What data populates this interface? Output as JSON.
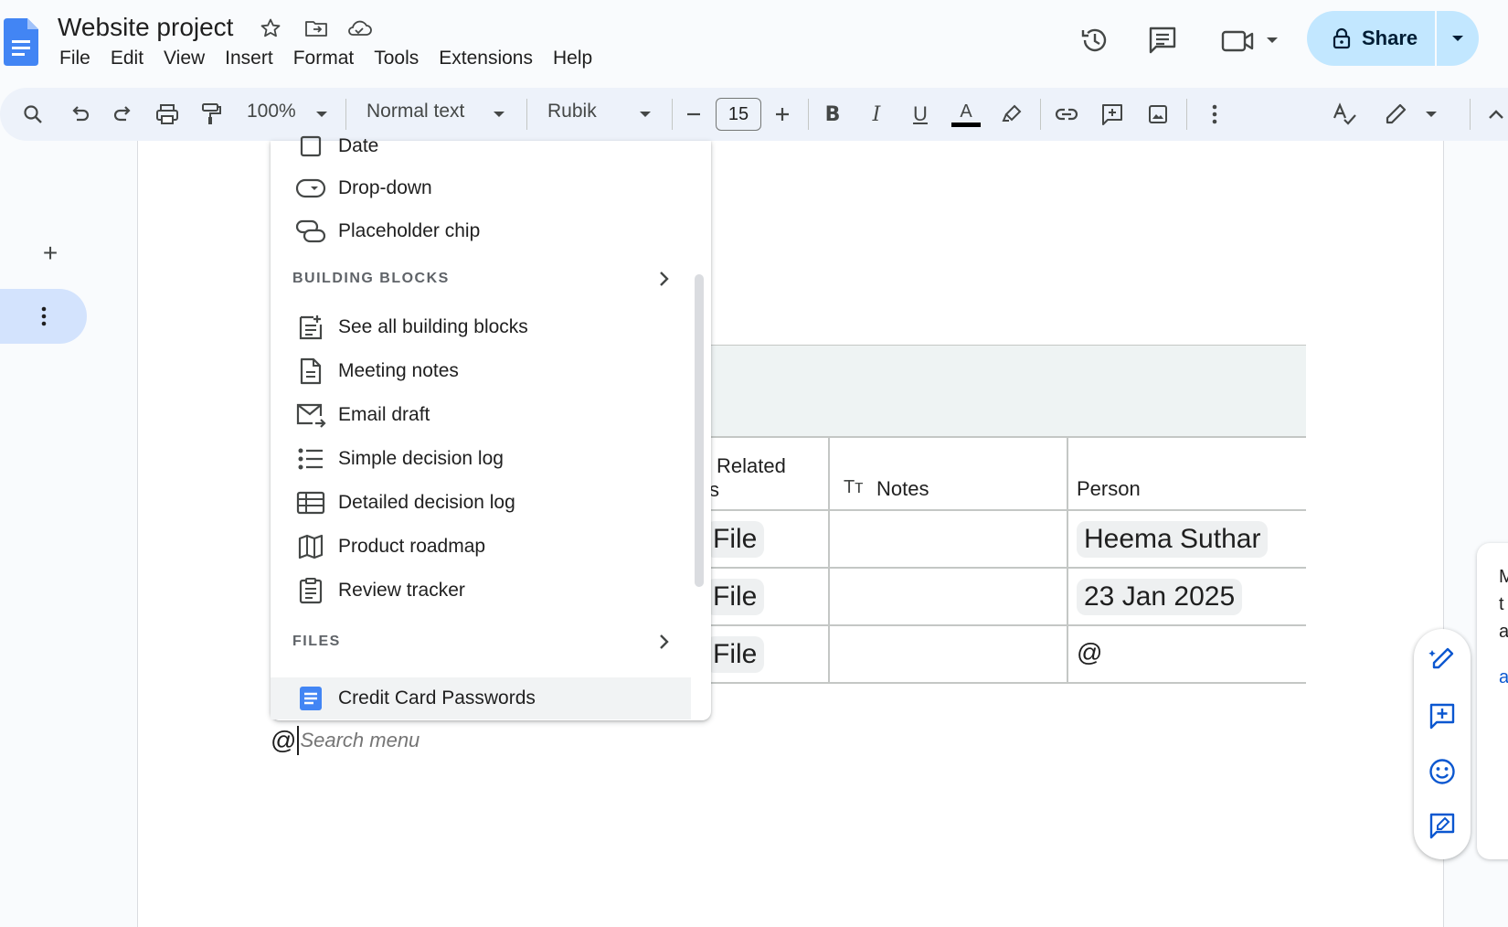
{
  "app": {
    "doc_title": "Website project",
    "menu": [
      "File",
      "Edit",
      "View",
      "Insert",
      "Format",
      "Tools",
      "Extensions",
      "Help"
    ],
    "share_label": "Share"
  },
  "toolbar": {
    "zoom": "100%",
    "style": "Normal text",
    "font": "Rubik",
    "font_size": "15",
    "bold": "B",
    "italic": "I",
    "underline": "U",
    "text_color": "A"
  },
  "insert_menu": {
    "top_items": [
      {
        "label": "Date",
        "icon": "calendar-icon"
      },
      {
        "label": "Drop-down",
        "icon": "dropdown-chip-icon"
      },
      {
        "label": "Placeholder chip",
        "icon": "placeholder-chip-icon"
      }
    ],
    "building_blocks_heading": "BUILDING BLOCKS",
    "building_blocks": [
      {
        "label": "See all building blocks",
        "icon": "add-doc-icon"
      },
      {
        "label": "Meeting notes",
        "icon": "document-icon"
      },
      {
        "label": "Email draft",
        "icon": "email-icon"
      },
      {
        "label": "Simple decision log",
        "icon": "list-icon"
      },
      {
        "label": "Detailed decision log",
        "icon": "table-icon"
      },
      {
        "label": "Product roadmap",
        "icon": "map-icon"
      },
      {
        "label": "Review tracker",
        "icon": "clipboard-icon"
      }
    ],
    "files_heading": "FILES",
    "files": [
      {
        "label": "Credit Card Passwords",
        "icon": "docs-file-icon"
      }
    ]
  },
  "search": {
    "trigger": "@",
    "placeholder": "Search menu"
  },
  "table": {
    "headers": {
      "related": "Related",
      "related_cut": "s",
      "notes": "Notes",
      "notes_prefix": "Tт",
      "person": "Person"
    },
    "rows": [
      {
        "related": "File",
        "notes": "",
        "person": "Heema Suthar"
      },
      {
        "related": "File",
        "notes": "",
        "person": "23 Jan 2025"
      },
      {
        "related": "File",
        "notes": "",
        "person": "@"
      }
    ]
  },
  "side_panel": {
    "letters": [
      "M",
      "t",
      "a",
      "a"
    ]
  },
  "colors": {
    "accent": "#0b57d0",
    "share_bg": "#c2e7ff",
    "toolbar_bg": "#edf2fa",
    "docs_blue": "#4285f4"
  }
}
